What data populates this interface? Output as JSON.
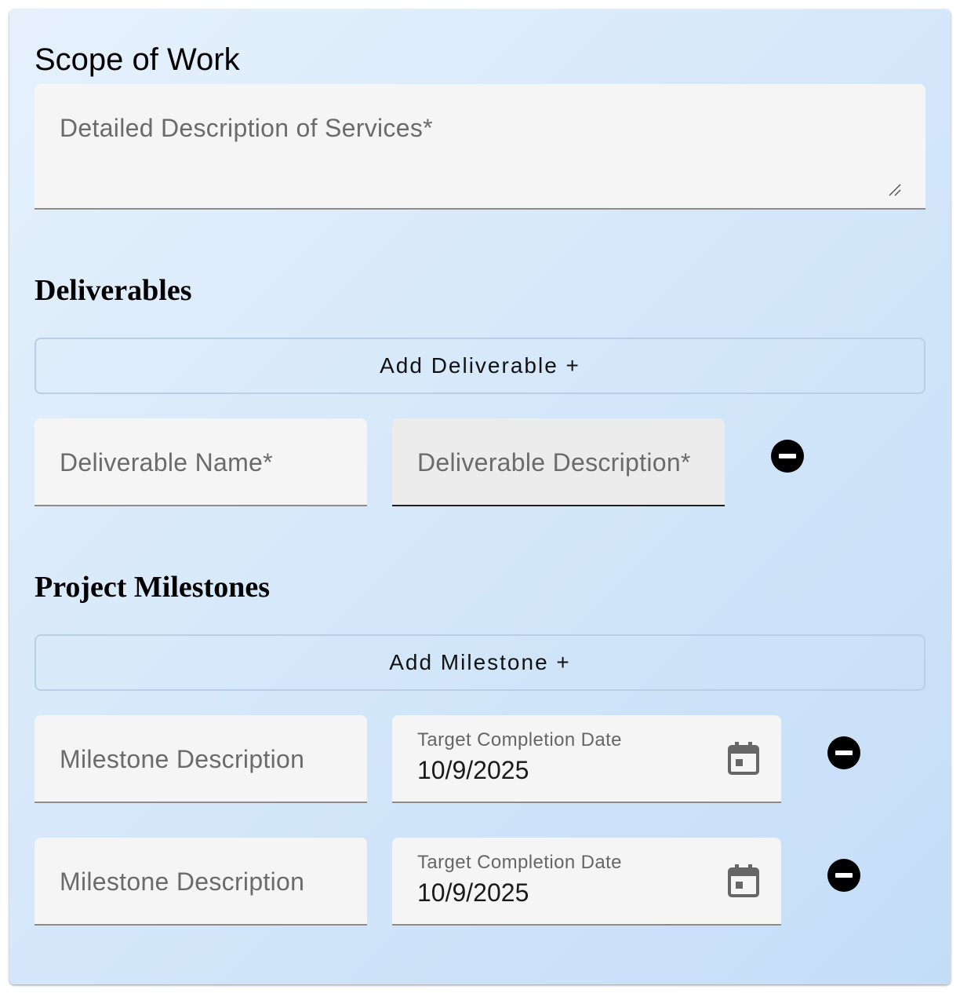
{
  "scope": {
    "title": "Scope of Work",
    "description_placeholder": "Detailed Description of Services*"
  },
  "deliverables": {
    "title": "Deliverables",
    "add_button_label": "Add Deliverable +",
    "items": [
      {
        "name_placeholder": "Deliverable Name*",
        "description_placeholder": "Deliverable Description*"
      }
    ]
  },
  "milestones": {
    "title": "Project Milestones",
    "add_button_label": "Add Milestone +",
    "items": [
      {
        "description_placeholder": "Milestone Description",
        "date_label": "Target Completion Date",
        "date_value": "10/9/2025"
      },
      {
        "description_placeholder": "Milestone Description",
        "date_label": "Target Completion Date",
        "date_value": "10/9/2025"
      }
    ]
  },
  "icons": {
    "remove": "minus-circle-icon",
    "calendar": "calendar-icon",
    "resize": "resize-handle-icon"
  },
  "colors": {
    "remove_button": "#000000",
    "field_background": "#f5f5f5",
    "button_border": "#b9cfe6"
  }
}
